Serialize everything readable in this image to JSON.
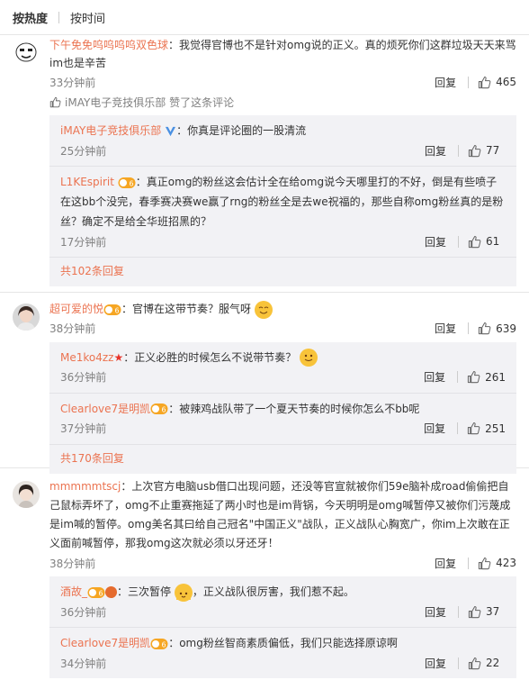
{
  "tabs": [
    {
      "label": "按热度",
      "active": true
    },
    {
      "label": "按时间",
      "active": false
    }
  ],
  "comments": [
    {
      "user": "下午免免呜呜呜呜双色球",
      "text": "：我觉得官博也不是针对omg说的正义。真的烦死你们这群垃圾天天来骂im也是辛苦",
      "time": "33分钟前",
      "reply": "回复",
      "likes": "465",
      "liked_by": "iMAY电子竞技俱乐部 赞了这条评论",
      "replies": [
        {
          "user": "iMAY电子竞技俱乐部",
          "text": "：你真是评论圈的一股清流",
          "time": "25分钟前",
          "reply": "回复",
          "likes": "77"
        },
        {
          "user": "L1KEspirit",
          "text": "：真正omg的粉丝这会估计全在给omg说今天哪里打的不好，倒是有些喷子在这bb个没完，春季赛决赛we赢了rng的粉丝全是去we祝福的，那些自称omg粉丝真的是粉丝？确定不是给全华班招黑的？",
          "time": "17分钟前",
          "reply": "回复",
          "likes": "61"
        }
      ],
      "more": "共102条回复"
    },
    {
      "user": "超可爱的悦",
      "text": "：官博在这带节奏？服气呀",
      "time": "38分钟前",
      "reply": "回复",
      "likes": "639",
      "replies": [
        {
          "user": "Me1ko4zz",
          "text": "：正义必胜的时候怎么不说带节奏？",
          "time": "36分钟前",
          "reply": "回复",
          "likes": "261"
        },
        {
          "user": "Clearlove7是明凯",
          "text": "：被辣鸡战队带了一个夏天节奏的时候你怎么不bb呢",
          "time": "37分钟前",
          "reply": "回复",
          "likes": "251"
        }
      ],
      "more": "共170条回复"
    },
    {
      "user": "mmmmmtscj",
      "text": "：上次官方电脑usb借口出现问题，还没等官宣就被你们59e脑补成road偷偷把自己鼠标弄坏了，omg不止重赛拖延了两小时也是im背锅，今天明明是omg喊暂停又被你们污蔑成是im喊的暂停。omg美名其曰给自己冠名\"中国正义\"战队，正义战队心胸宽广，你im上次敢在正义面前喊暂停，那我omg这次就必须以牙还牙！",
      "time": "38分钟前",
      "reply": "回复",
      "likes": "423",
      "replies": [
        {
          "user": "酒故_",
          "text": "：三次暂停",
          "text2": "，正义战队很厉害，我们惹不起。",
          "time": "36分钟前",
          "reply": "回复",
          "likes": "37"
        },
        {
          "user": "Clearlove7是明凯",
          "text": "：omg粉丝智商素质偏低，我们只能选择原谅啊",
          "time": "34分钟前",
          "reply": "回复",
          "likes": "22"
        }
      ]
    }
  ],
  "colors": {
    "username": "#eb7350",
    "subbox": "#f2f2f5",
    "meta": "#808080",
    "border": "#e6e6e6"
  },
  "icons": [
    "like-icon",
    "vip-badge-icon",
    "verified-v-icon",
    "smile-emoji-icon"
  ]
}
